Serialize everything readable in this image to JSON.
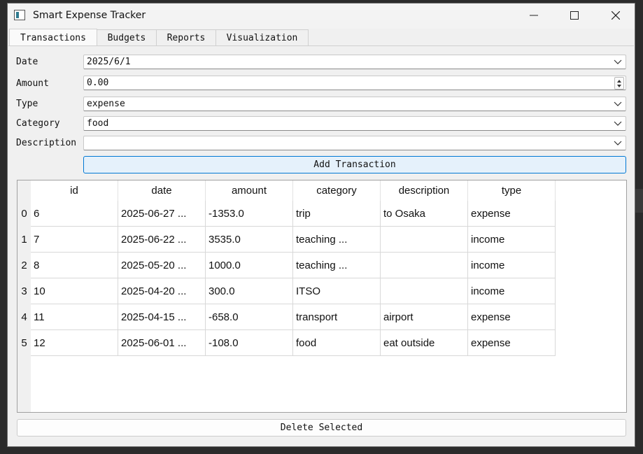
{
  "window": {
    "title": "Smart Expense Tracker"
  },
  "tabs": [
    {
      "label": "Transactions",
      "active": true
    },
    {
      "label": "Budgets",
      "active": false
    },
    {
      "label": "Reports",
      "active": false
    },
    {
      "label": "Visualization",
      "active": false
    }
  ],
  "form": {
    "date": {
      "label": "Date",
      "value": "2025/6/1"
    },
    "amount": {
      "label": "Amount",
      "value": "0.00"
    },
    "type": {
      "label": "Type",
      "value": "expense"
    },
    "category": {
      "label": "Category",
      "value": "food"
    },
    "description": {
      "label": "Description",
      "value": ""
    },
    "add_button": "Add Transaction"
  },
  "table": {
    "columns": [
      "id",
      "date",
      "amount",
      "category",
      "description",
      "type"
    ],
    "row_headers": [
      "0",
      "1",
      "2",
      "3",
      "4",
      "5"
    ],
    "rows": [
      [
        "6",
        "2025-06-27 ...",
        "-1353.0",
        "trip",
        "to Osaka",
        "expense"
      ],
      [
        "7",
        "2025-06-22 ...",
        "3535.0",
        "teaching ...",
        "",
        "income"
      ],
      [
        "8",
        "2025-05-20 ...",
        "1000.0",
        "teaching ...",
        "",
        "income"
      ],
      [
        "10",
        "2025-04-20 ...",
        "300.0",
        "ITSO",
        "",
        "income"
      ],
      [
        "11",
        "2025-04-15 ...",
        "-658.0",
        "transport",
        "airport",
        "expense"
      ],
      [
        "12",
        "2025-06-01 ...",
        "-108.0",
        "food",
        "eat outside",
        "expense"
      ]
    ]
  },
  "delete_button": "Delete Selected",
  "colors": {
    "accent": "#0078d4",
    "button_fill": "#e5f1fb"
  }
}
